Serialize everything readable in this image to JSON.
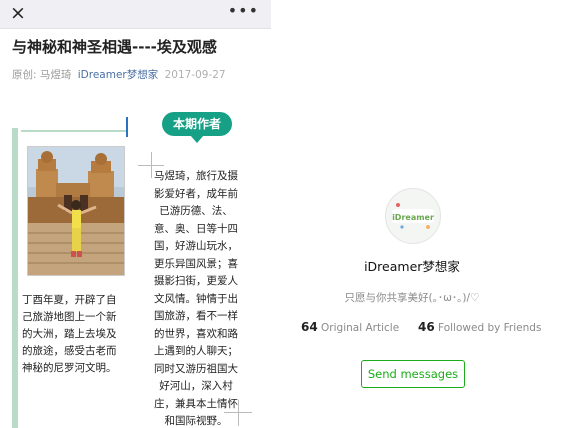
{
  "topbar": {
    "close_icon": "×",
    "more_icon": "•••"
  },
  "article": {
    "title": "与神秘和神圣相遇----埃及观感",
    "meta_prefix": "原创:",
    "author": "马煜琦",
    "account": "iDreamer梦想家",
    "date": "2017-09-27",
    "badge": "本期作者",
    "caption_lines": [
      "丁酉年夏，开辟了自",
      "己旅游地图上一个新",
      "的大洲，踏上去埃及",
      "的旅途，感受古老而",
      "神秘的尼罗河文明。"
    ],
    "bio_lines": [
      "马煜琦，旅行及摄",
      "影爱好者，成年前",
      "已游历德、法、",
      "意、奥、日等十四",
      "国，好游山玩水，",
      "更乐异国风景；喜",
      "摄影扫街，更爱人",
      "文风情。钟情于出",
      "国旅游，看不一样",
      "的世界，喜欢和路",
      "上遇到的人聊天；",
      "同时又游历祖国大",
      "好河山，深入村",
      "庄，兼具本土情怀",
      "和国际视野。"
    ]
  },
  "account_card": {
    "logo_text": "iDreamer",
    "name": "iDreamer梦想家",
    "description": "只愿与你共享美好(｡･ω･｡)/♡",
    "articles_count": "64",
    "articles_label": "Original Article",
    "friends_count": "46",
    "friends_label": "Followed by Friends",
    "send_button": "Send messages"
  },
  "colors": {
    "accent_green": "#1aad19",
    "badge_teal": "#16a086",
    "card_border": "#b8dcc7",
    "link_blue": "#4a6fa5"
  }
}
